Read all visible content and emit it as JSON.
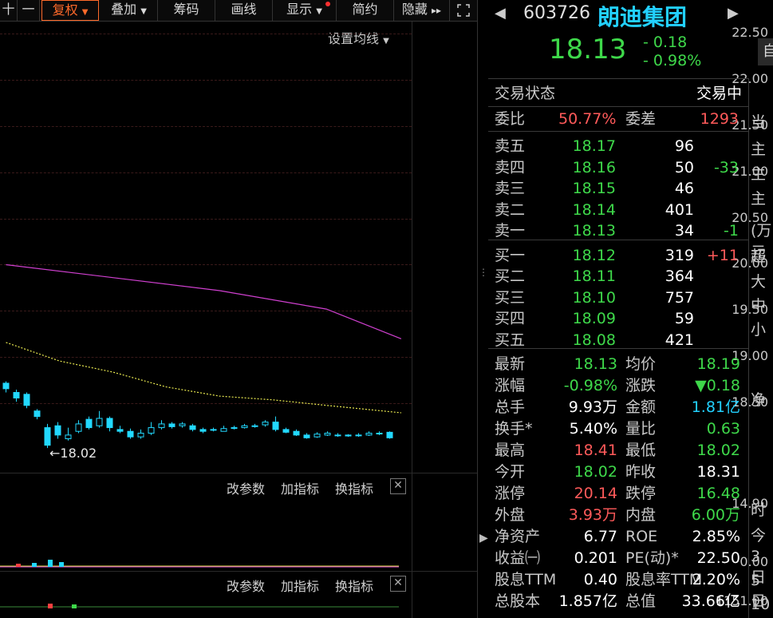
{
  "toolbar": {
    "items": [
      "十",
      "一",
      "复权",
      "叠加",
      "筹码",
      "画线",
      "显示",
      "简约",
      "隐藏"
    ]
  },
  "chart": {
    "setting_label": "设置均线",
    "yticks": [
      "22.50",
      "22.00",
      "21.50",
      "21.00",
      "20.50",
      "20.00",
      "19.50",
      "19.00",
      "18.50"
    ],
    "low_annotation": "18.02",
    "sub1": {
      "btn1": "改参数",
      "btn2": "加指标",
      "btn3": "换指标",
      "top": "14.90",
      "bottom": "0.00"
    },
    "sub2": {
      "btn1": "改参数",
      "btn2": "加指标",
      "btn3": "换指标",
      "top": "1151.00"
    }
  },
  "chart_data": {
    "type": "candlestick",
    "ylim": [
      17.9,
      22.6
    ],
    "candles": [
      {
        "o": 18.72,
        "c": 18.66,
        "h": 18.74,
        "l": 18.62
      },
      {
        "o": 18.62,
        "c": 18.56,
        "h": 18.65,
        "l": 18.52
      },
      {
        "o": 18.6,
        "c": 18.48,
        "h": 18.62,
        "l": 18.45
      },
      {
        "o": 18.42,
        "c": 18.36,
        "h": 18.44,
        "l": 18.33
      },
      {
        "o": 18.24,
        "c": 18.05,
        "h": 18.28,
        "l": 18.02
      },
      {
        "o": 18.26,
        "c": 18.16,
        "h": 18.3,
        "l": 18.12
      },
      {
        "o": 18.12,
        "c": 18.16,
        "h": 18.24,
        "l": 18.1
      },
      {
        "o": 18.2,
        "c": 18.28,
        "h": 18.32,
        "l": 18.18
      },
      {
        "o": 18.33,
        "c": 18.24,
        "h": 18.36,
        "l": 18.22
      },
      {
        "o": 18.26,
        "c": 18.34,
        "h": 18.42,
        "l": 18.24
      },
      {
        "o": 18.34,
        "c": 18.24,
        "h": 18.36,
        "l": 18.2
      },
      {
        "o": 18.22,
        "c": 18.2,
        "h": 18.26,
        "l": 18.18
      },
      {
        "o": 18.2,
        "c": 18.14,
        "h": 18.23,
        "l": 18.12
      },
      {
        "o": 18.14,
        "c": 18.18,
        "h": 18.22,
        "l": 18.12
      },
      {
        "o": 18.18,
        "c": 18.24,
        "h": 18.3,
        "l": 18.16
      },
      {
        "o": 18.24,
        "c": 18.28,
        "h": 18.32,
        "l": 18.22
      },
      {
        "o": 18.28,
        "c": 18.25,
        "h": 18.3,
        "l": 18.23
      },
      {
        "o": 18.26,
        "c": 18.28,
        "h": 18.3,
        "l": 18.24
      },
      {
        "o": 18.26,
        "c": 18.22,
        "h": 18.28,
        "l": 18.2
      },
      {
        "o": 18.22,
        "c": 18.2,
        "h": 18.24,
        "l": 18.18
      },
      {
        "o": 18.22,
        "c": 18.22,
        "h": 18.24,
        "l": 18.2
      },
      {
        "o": 18.2,
        "c": 18.23,
        "h": 18.26,
        "l": 18.2
      },
      {
        "o": 18.24,
        "c": 18.24,
        "h": 18.26,
        "l": 18.22
      },
      {
        "o": 18.24,
        "c": 18.26,
        "h": 18.28,
        "l": 18.23
      },
      {
        "o": 18.26,
        "c": 18.26,
        "h": 18.28,
        "l": 18.24
      },
      {
        "o": 18.27,
        "c": 18.3,
        "h": 18.32,
        "l": 18.25
      },
      {
        "o": 18.3,
        "c": 18.22,
        "h": 18.36,
        "l": 18.2
      },
      {
        "o": 18.22,
        "c": 18.19,
        "h": 18.24,
        "l": 18.18
      },
      {
        "o": 18.2,
        "c": 18.16,
        "h": 18.22,
        "l": 18.15
      },
      {
        "o": 18.16,
        "c": 18.13,
        "h": 18.18,
        "l": 18.12
      },
      {
        "o": 18.14,
        "c": 18.17,
        "h": 18.19,
        "l": 18.13
      },
      {
        "o": 18.16,
        "c": 18.18,
        "h": 18.2,
        "l": 18.15
      },
      {
        "o": 18.16,
        "c": 18.16,
        "h": 18.18,
        "l": 18.14
      },
      {
        "o": 18.16,
        "c": 18.15,
        "h": 18.17,
        "l": 18.14
      },
      {
        "o": 18.16,
        "c": 18.16,
        "h": 18.18,
        "l": 18.14
      },
      {
        "o": 18.16,
        "c": 18.18,
        "h": 18.2,
        "l": 18.15
      },
      {
        "o": 18.18,
        "c": 18.18,
        "h": 18.2,
        "l": 18.16
      },
      {
        "o": 18.19,
        "c": 18.13,
        "h": 18.2,
        "l": 18.12
      }
    ],
    "ma_long": [
      [
        0,
        20.0
      ],
      [
        10,
        19.86
      ],
      [
        20,
        19.72
      ],
      [
        30,
        19.52
      ],
      [
        37,
        19.2
      ]
    ],
    "ma_short": [
      [
        0,
        19.16
      ],
      [
        5,
        18.96
      ],
      [
        10,
        18.84
      ],
      [
        15,
        18.68
      ],
      [
        20,
        18.58
      ],
      [
        25,
        18.54
      ],
      [
        30,
        18.48
      ],
      [
        37,
        18.4
      ]
    ],
    "colors": {
      "candle": "#22d8ff",
      "ma_long": "#d040d0",
      "ma_short": "#e8e850"
    }
  },
  "quote": {
    "code": "603726",
    "name": "朗迪集团",
    "price": "18.13",
    "change": "- 0.18",
    "change_pct": "- 0.98%",
    "side_btn": "自",
    "status_label": "交易状态",
    "status_value": "交易中",
    "weibi_label": "委比",
    "weibi_value": "50.77%",
    "weicha_label": "委差",
    "weicha_value": "1293",
    "asks": [
      {
        "label": "卖五",
        "price": "18.17",
        "vol": "96",
        "delta": ""
      },
      {
        "label": "卖四",
        "price": "18.16",
        "vol": "50",
        "delta": "-33"
      },
      {
        "label": "卖三",
        "price": "18.15",
        "vol": "46",
        "delta": ""
      },
      {
        "label": "卖二",
        "price": "18.14",
        "vol": "401",
        "delta": ""
      },
      {
        "label": "卖一",
        "price": "18.13",
        "vol": "34",
        "delta": "-1"
      }
    ],
    "bids": [
      {
        "label": "买一",
        "price": "18.12",
        "vol": "319",
        "delta": "+11"
      },
      {
        "label": "买二",
        "price": "18.11",
        "vol": "364",
        "delta": ""
      },
      {
        "label": "买三",
        "price": "18.10",
        "vol": "757",
        "delta": ""
      },
      {
        "label": "买四",
        "price": "18.09",
        "vol": "59",
        "delta": ""
      },
      {
        "label": "买五",
        "price": "18.08",
        "vol": "421",
        "delta": ""
      }
    ],
    "stats": [
      {
        "l1": "最新",
        "v1": "18.13",
        "c1": "down",
        "l2": "均价",
        "v2": "18.19",
        "c2": "down"
      },
      {
        "l1": "涨幅",
        "v1": "-0.98%",
        "c1": "down",
        "l2": "涨跌",
        "v2": "▼0.18",
        "c2": "down"
      },
      {
        "l1": "总手",
        "v1": "9.93万",
        "c1": "wht",
        "l2": "金额",
        "v2": "1.81亿",
        "c2": "cyan"
      },
      {
        "l1": "换手*",
        "v1": "5.40%",
        "c1": "wht",
        "l2": "量比",
        "v2": "0.63",
        "c2": "down"
      },
      {
        "l1": "最高",
        "v1": "18.41",
        "c1": "up",
        "l2": "最低",
        "v2": "18.02",
        "c2": "down"
      },
      {
        "l1": "今开",
        "v1": "18.02",
        "c1": "down",
        "l2": "昨收",
        "v2": "18.31",
        "c2": "wht"
      },
      {
        "l1": "涨停",
        "v1": "20.14",
        "c1": "up",
        "l2": "跌停",
        "v2": "16.48",
        "c2": "down"
      },
      {
        "l1": "外盘",
        "v1": "3.93万",
        "c1": "up",
        "l2": "内盘",
        "v2": "6.00万",
        "c2": "down"
      },
      {
        "l1": "净资产",
        "v1": "6.77",
        "c1": "wht",
        "l2": "ROE",
        "v2": "2.85%",
        "c2": "wht"
      },
      {
        "l1": "收益㈠",
        "v1": "0.201",
        "c1": "wht",
        "l2": "PE(动)*",
        "v2": "22.50",
        "c2": "wht"
      },
      {
        "l1": "股息TTM",
        "v1": "0.40",
        "c1": "wht",
        "l2": "股息率TTM",
        "v2": "2.20%",
        "c2": "wht"
      },
      {
        "l1": "总股本",
        "v1": "1.857亿",
        "c1": "wht",
        "l2": "总值",
        "v2": "33.66亿",
        "c2": "wht"
      }
    ]
  },
  "right_strip": {
    "items": [
      "当",
      "主",
      "主",
      "主",
      "(万元",
      "超",
      "大",
      "中",
      "小",
      "净",
      "时",
      "今",
      "3 日",
      "5 日",
      "10"
    ]
  }
}
